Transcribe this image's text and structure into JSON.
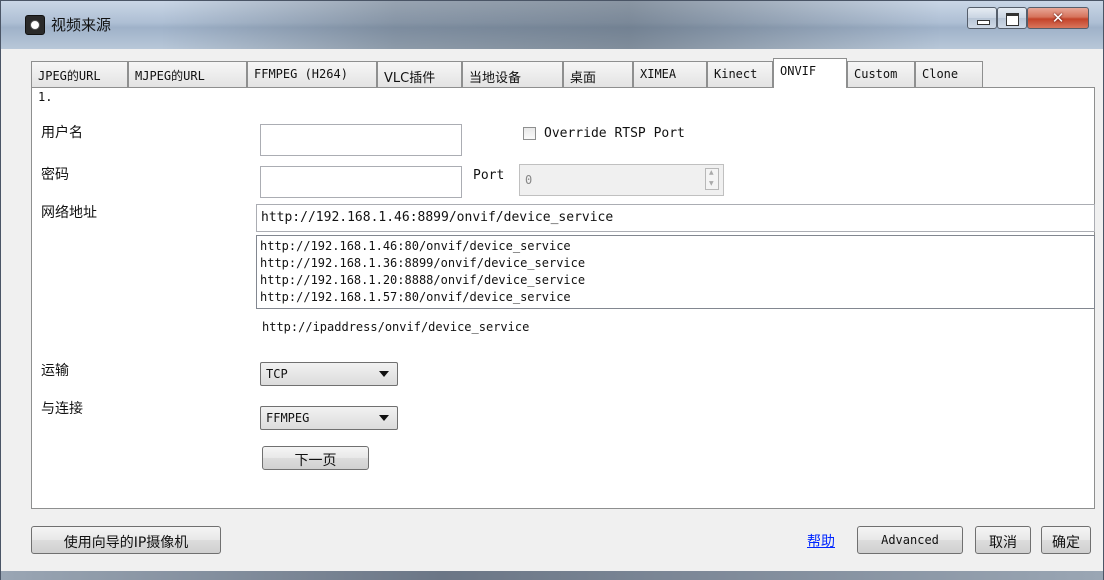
{
  "window": {
    "title": "视频来源"
  },
  "tabs": [
    {
      "label": "JPEG的URL"
    },
    {
      "label": "MJPEG的URL"
    },
    {
      "label": "FFMPEG (H264)"
    },
    {
      "label": "VLC插件"
    },
    {
      "label": "当地设备"
    },
    {
      "label": "桌面"
    },
    {
      "label": "XIMEA"
    },
    {
      "label": "Kinect"
    },
    {
      "label": "ONVIF",
      "active": true
    },
    {
      "label": "Custom"
    },
    {
      "label": "Clone"
    }
  ],
  "form": {
    "step": "1.",
    "username_label": "用户名",
    "username_value": "",
    "password_label": "密码",
    "password_value": "",
    "override_label": "Override RTSP Port",
    "override_checked": false,
    "port_label": "Port",
    "port_value": "0",
    "address_label": "网络地址",
    "address_value": "http://192.168.1.46:8899/onvif/device_service",
    "address_list": [
      "http://192.168.1.46:80/onvif/device_service",
      "http://192.168.1.36:8899/onvif/device_service",
      "http://192.168.1.20:8888/onvif/device_service",
      "http://192.168.1.57:80/onvif/device_service"
    ],
    "address_hint": "http://ipaddress/onvif/device_service",
    "transport_label": "运输",
    "transport_value": "TCP",
    "connect_label": "与连接",
    "connect_value": "FFMPEG",
    "next_button": "下一页"
  },
  "footer": {
    "wizard_button": "使用向导的IP摄像机",
    "help_link": "帮助",
    "advanced_button": "Advanced",
    "cancel_button": "取消",
    "ok_button": "确定"
  }
}
